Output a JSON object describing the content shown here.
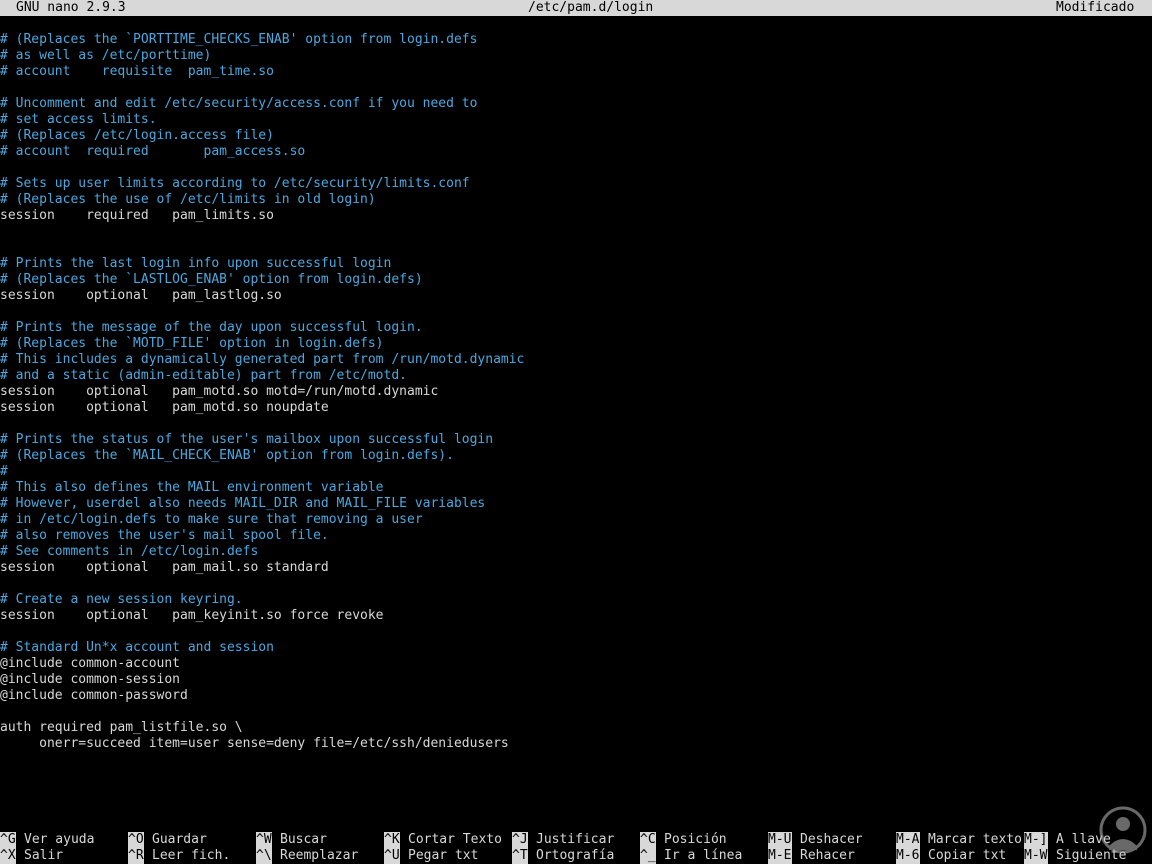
{
  "title_bar": {
    "app_name": "GNU nano 2.9.3",
    "file_path": "/etc/pam.d/login",
    "status": "Modificado"
  },
  "editor": {
    "lines": [
      {
        "text": "# (Replaces the `PORTTIME_CHECKS_ENAB' option from login.defs",
        "kind": "comment"
      },
      {
        "text": "# as well as /etc/porttime)",
        "kind": "comment"
      },
      {
        "text": "# account    requisite  pam_time.so",
        "kind": "comment"
      },
      {
        "text": "",
        "kind": "code"
      },
      {
        "text": "# Uncomment and edit /etc/security/access.conf if you need to",
        "kind": "comment"
      },
      {
        "text": "# set access limits.",
        "kind": "comment"
      },
      {
        "text": "# (Replaces /etc/login.access file)",
        "kind": "comment"
      },
      {
        "text": "# account  required       pam_access.so",
        "kind": "comment"
      },
      {
        "text": "",
        "kind": "code"
      },
      {
        "text": "# Sets up user limits according to /etc/security/limits.conf",
        "kind": "comment"
      },
      {
        "text": "# (Replaces the use of /etc/limits in old login)",
        "kind": "comment"
      },
      {
        "text": "session    required   pam_limits.so",
        "kind": "code"
      },
      {
        "text": "",
        "kind": "code"
      },
      {
        "text": "",
        "kind": "code"
      },
      {
        "text": "# Prints the last login info upon successful login",
        "kind": "comment"
      },
      {
        "text": "# (Replaces the `LASTLOG_ENAB' option from login.defs)",
        "kind": "comment"
      },
      {
        "text": "session    optional   pam_lastlog.so",
        "kind": "code"
      },
      {
        "text": "",
        "kind": "code"
      },
      {
        "text": "# Prints the message of the day upon successful login.",
        "kind": "comment"
      },
      {
        "text": "# (Replaces the `MOTD_FILE' option in login.defs)",
        "kind": "comment"
      },
      {
        "text": "# This includes a dynamically generated part from /run/motd.dynamic",
        "kind": "comment"
      },
      {
        "text": "# and a static (admin-editable) part from /etc/motd.",
        "kind": "comment"
      },
      {
        "text": "session    optional   pam_motd.so motd=/run/motd.dynamic",
        "kind": "code"
      },
      {
        "text": "session    optional   pam_motd.so noupdate",
        "kind": "code"
      },
      {
        "text": "",
        "kind": "code"
      },
      {
        "text": "# Prints the status of the user's mailbox upon successful login",
        "kind": "comment"
      },
      {
        "text": "# (Replaces the `MAIL_CHECK_ENAB' option from login.defs).",
        "kind": "comment"
      },
      {
        "text": "#",
        "kind": "comment"
      },
      {
        "text": "# This also defines the MAIL environment variable",
        "kind": "comment"
      },
      {
        "text": "# However, userdel also needs MAIL_DIR and MAIL_FILE variables",
        "kind": "comment"
      },
      {
        "text": "# in /etc/login.defs to make sure that removing a user",
        "kind": "comment"
      },
      {
        "text": "# also removes the user's mail spool file.",
        "kind": "comment"
      },
      {
        "text": "# See comments in /etc/login.defs",
        "kind": "comment"
      },
      {
        "text": "session    optional   pam_mail.so standard",
        "kind": "code"
      },
      {
        "text": "",
        "kind": "code"
      },
      {
        "text": "# Create a new session keyring.",
        "kind": "comment"
      },
      {
        "text": "session    optional   pam_keyinit.so force revoke",
        "kind": "code"
      },
      {
        "text": "",
        "kind": "code"
      },
      {
        "text": "# Standard Un*x account and session",
        "kind": "comment"
      },
      {
        "text": "@include common-account",
        "kind": "code"
      },
      {
        "text": "@include common-session",
        "kind": "code"
      },
      {
        "text": "@include common-password",
        "kind": "code"
      },
      {
        "text": "",
        "kind": "code"
      },
      {
        "text": "auth required pam_listfile.so \\",
        "kind": "code"
      },
      {
        "text": "     onerr=succeed item=user sense=deny file=/etc/ssh/deniedusers",
        "kind": "code"
      }
    ]
  },
  "shortcuts": {
    "row1": [
      {
        "key": "^G",
        "label": "Ver ayuda"
      },
      {
        "key": "^O",
        "label": "Guardar"
      },
      {
        "key": "^W",
        "label": "Buscar"
      },
      {
        "key": "^K",
        "label": "Cortar Texto"
      },
      {
        "key": "^J",
        "label": "Justificar"
      },
      {
        "key": "^C",
        "label": "Posición"
      },
      {
        "key": "M-U",
        "label": "Deshacer"
      },
      {
        "key": "M-A",
        "label": "Marcar texto"
      },
      {
        "key": "M-]",
        "label": "A llave"
      }
    ],
    "row2": [
      {
        "key": "^X",
        "label": "Salir"
      },
      {
        "key": "^R",
        "label": "Leer fich."
      },
      {
        "key": "^\\",
        "label": "Reemplazar"
      },
      {
        "key": "^U",
        "label": "Pegar txt"
      },
      {
        "key": "^T",
        "label": "Ortografía"
      },
      {
        "key": "^_",
        "label": "Ir a línea"
      },
      {
        "key": "M-E",
        "label": "Rehacer"
      },
      {
        "key": "M-6",
        "label": "Copiar txt"
      },
      {
        "key": "M-W",
        "label": "Siguiente"
      }
    ]
  },
  "colors": {
    "comment": "#4aa8e0",
    "text": "#d8d8d8",
    "bar_bg": "#d8d8d8",
    "background": "#000000"
  }
}
